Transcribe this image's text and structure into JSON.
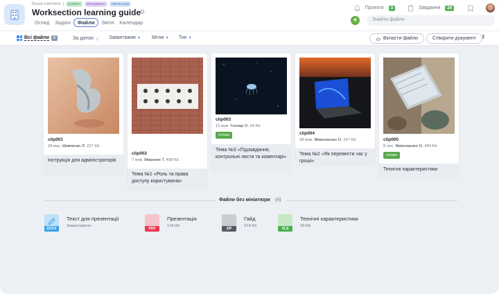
{
  "header": {
    "breadcrumb": "Ваша компанія",
    "tags": [
      "В роботі",
      "Менеджмент",
      "Презентація"
    ],
    "title": "Worksection learning guide",
    "tabs": [
      "Огляд",
      "Задачі",
      "Файли",
      "Звіти",
      "Календар"
    ],
    "active_tab": "Файли",
    "projects_label": "Проекти",
    "projects_count": "3",
    "tasks_label": "Завдання",
    "tasks_count": "24",
    "search_placeholder": "Знайти файли"
  },
  "toolbar": {
    "all_files": "Всі файли",
    "all_files_count": "8",
    "sort_label": "За датою",
    "uploaded_label": "Завантажив",
    "tags_label": "Мітки",
    "type_label": "Тип",
    "attach_label": "Вкласти файли",
    "create_doc_label": "Створити документ"
  },
  "cards": [
    {
      "name": "clip001",
      "date": "28 вер.",
      "author": "Шевченко Л.",
      "size": "227 Kb",
      "status": "",
      "task": "Інструкція для адміністраторів"
    },
    {
      "name": "clip002",
      "date": "7 жов.",
      "author": "Миронек Т.",
      "size": "458 Kb",
      "status": "",
      "task": "Тема №1 «Роль та права доступу користувачів»"
    },
    {
      "name": "clip003",
      "date": "15 жов.",
      "author": "Гончар О.",
      "size": "59 Kb",
      "status": "готово",
      "task": "Тема №3 «Підзавдання, контрольні листи та коментарі»"
    },
    {
      "name": "clip004",
      "date": "28 жов.",
      "author": "Миколаєнко О.",
      "size": "167 Kb",
      "status": "",
      "task": "Тема №2 «Як перевести час у гроші»"
    },
    {
      "name": "clip005",
      "date": "8 лис.",
      "author": "Миколаєнко О.",
      "size": "494 Kb",
      "status": "готово",
      "task": "Технічні характеристики"
    }
  ],
  "no_thumb_section": {
    "title": "Файли без мініатюри",
    "count": "(4)",
    "files": [
      {
        "name": "Текст для презентації",
        "sub": "Завантажено",
        "ext": "DOCX",
        "color": "#3aa0e8",
        "light": "#bfe1f8"
      },
      {
        "name": "Презентація",
        "sub": "124 Kb",
        "ext": "PDF",
        "color": "#e5394f",
        "light": "#f6c5cc"
      },
      {
        "name": "Гайд",
        "sub": "514 Kb",
        "ext": "ZIP",
        "color": "#555b63",
        "light": "#c9ccd0"
      },
      {
        "name": "Технічні характеристики",
        "sub": "39 Kb",
        "ext": "XLS",
        "color": "#4caf50",
        "light": "#c6e8c6"
      }
    ]
  },
  "colors": {
    "accent": "#3b82f6",
    "ready": "#5aa84a",
    "active_tab_border": "#5b79d9"
  }
}
